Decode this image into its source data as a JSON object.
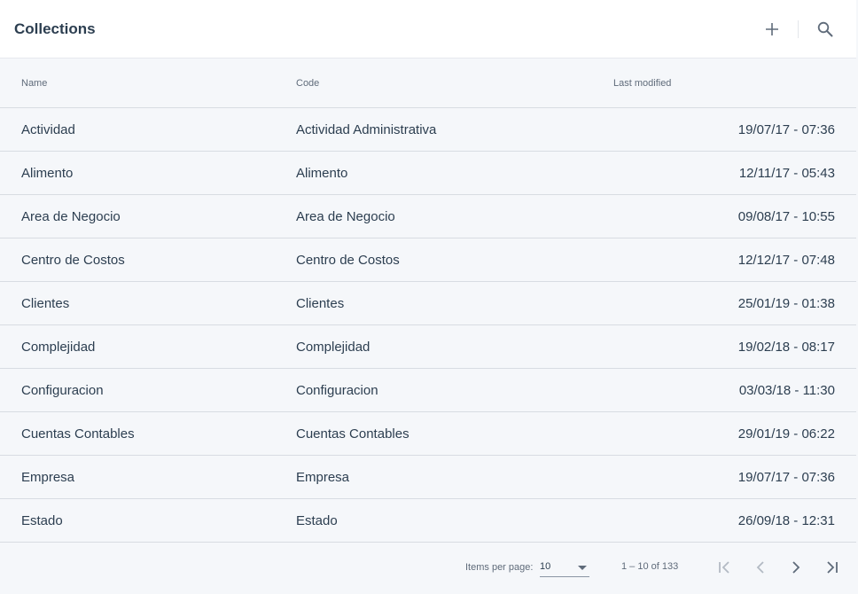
{
  "header": {
    "title": "Collections",
    "icons": [
      "plus-icon",
      "search-icon"
    ]
  },
  "table": {
    "columns": {
      "name": "Name",
      "code": "Code",
      "last_modified": "Last modified"
    },
    "rows": [
      {
        "name": "Actividad",
        "code": "Actividad Administrativa",
        "modified": "19/07/17 - 07:36"
      },
      {
        "name": "Alimento",
        "code": "Alimento",
        "modified": "12/11/17 - 05:43"
      },
      {
        "name": "Area de Negocio",
        "code": "Area de Negocio",
        "modified": "09/08/17 - 10:55"
      },
      {
        "name": "Centro de Costos",
        "code": "Centro de Costos",
        "modified": "12/12/17 - 07:48"
      },
      {
        "name": "Clientes",
        "code": "Clientes",
        "modified": "25/01/19 - 01:38"
      },
      {
        "name": "Complejidad",
        "code": "Complejidad",
        "modified": "19/02/18 - 08:17"
      },
      {
        "name": "Configuracion",
        "code": "Configuracion",
        "modified": "03/03/18 - 11:30"
      },
      {
        "name": "Cuentas Contables",
        "code": "Cuentas Contables",
        "modified": "29/01/19 - 06:22"
      },
      {
        "name": "Empresa",
        "code": "Empresa",
        "modified": "19/07/17 - 07:36"
      },
      {
        "name": "Estado",
        "code": "Estado",
        "modified": "26/09/18 - 12:31"
      }
    ]
  },
  "paginator": {
    "items_per_page_label": "Items per page:",
    "items_per_page_value": "10",
    "range_label": "1 – 10 of 133",
    "icons": [
      "first-page-icon",
      "previous-page-icon",
      "next-page-icon",
      "last-page-icon"
    ]
  },
  "colors": {
    "background": "#f5f7fa",
    "header_bg": "#ffffff",
    "text": "#2c3e50",
    "muted_text": "#5f6b7a",
    "divider": "#d8dce2"
  }
}
